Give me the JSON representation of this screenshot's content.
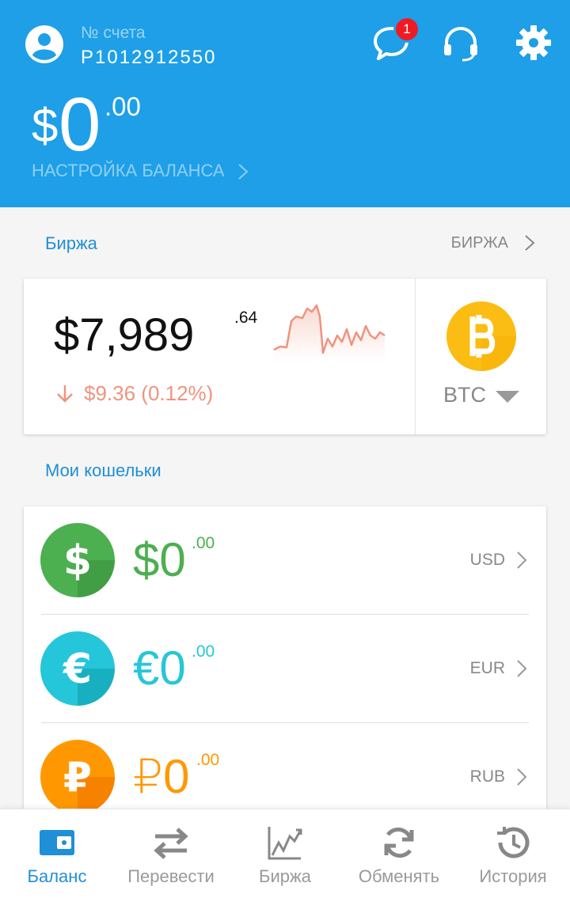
{
  "header": {
    "account_label": "№ счета",
    "account_number": "P1012912550",
    "notification_count": "1",
    "balance_currency": "$",
    "balance_int": "0",
    "balance_cents": ".00",
    "balance_setup_label": "НАСТРОЙКА БАЛАНСА"
  },
  "exchange": {
    "section_title": "Биржа",
    "link_label": "БИРЖА",
    "rate_int": "$7,989",
    "rate_cents": ".64",
    "change_text": "$9.36 (0.12%)",
    "change_direction": "down",
    "coin_label": "BTC"
  },
  "wallets": {
    "section_title": "Мои кошельки",
    "items": [
      {
        "symbol_amount": "$0",
        "cents": ".00",
        "code": "USD",
        "color": "#4caf50",
        "icon": "dollar-icon"
      },
      {
        "symbol_amount": "€0",
        "cents": ".00",
        "code": "EUR",
        "color": "#26c6da",
        "icon": "euro-icon"
      },
      {
        "symbol_amount": "₽0",
        "cents": ".00",
        "code": "RUB",
        "color": "#ff9800",
        "icon": "ruble-icon"
      }
    ]
  },
  "nav": {
    "items": [
      {
        "label": "Баланс",
        "icon": "wallet-icon",
        "active": true
      },
      {
        "label": "Перевести",
        "icon": "transfer-icon",
        "active": false
      },
      {
        "label": "Биржа",
        "icon": "chart-icon",
        "active": false
      },
      {
        "label": "Обменять",
        "icon": "exchange-icon",
        "active": false
      },
      {
        "label": "История",
        "icon": "history-icon",
        "active": false
      }
    ]
  },
  "colors": {
    "header_bg": "#1e9fe8",
    "accent": "#1f8fd6",
    "negative": "#f0937e",
    "btc": "#fbbd13"
  }
}
